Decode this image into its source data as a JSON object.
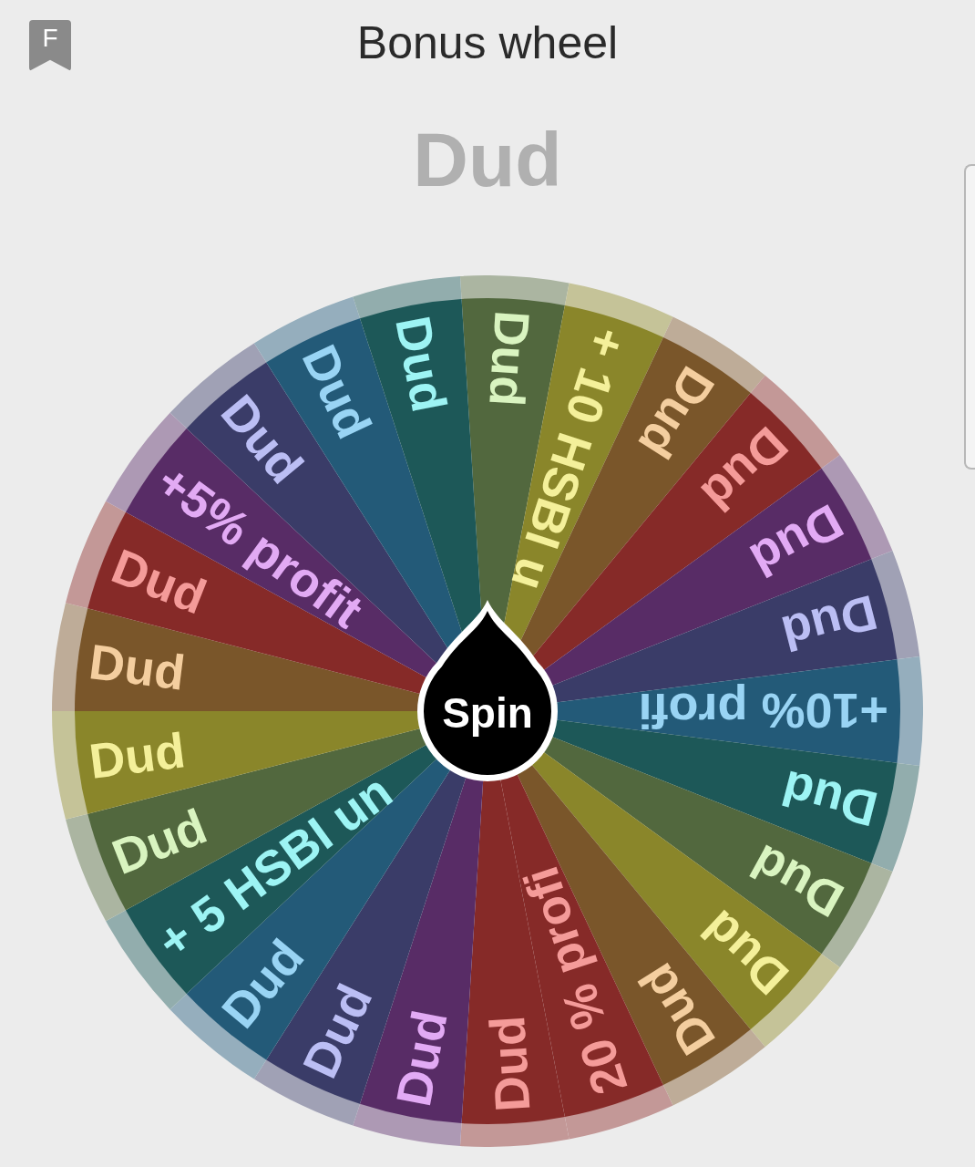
{
  "header": {
    "title": "Bonus wheel",
    "badge": "F"
  },
  "result": "Dud",
  "wheel": {
    "segments": [
      {
        "label": "Dud",
        "color": "#52683e"
      },
      {
        "label": "+ 10 HSBI u",
        "color": "#8a862a"
      },
      {
        "label": "Dud",
        "color": "#7a562a"
      },
      {
        "label": "Dud",
        "color": "#862a28"
      },
      {
        "label": "Dud",
        "color": "#582c66"
      },
      {
        "label": "Dud",
        "color": "#3a3c68"
      },
      {
        "label": "+10% profi",
        "color": "#235a78"
      },
      {
        "label": "Dud",
        "color": "#1d5858"
      },
      {
        "label": "Dud",
        "color": "#52683e"
      },
      {
        "label": "Dud",
        "color": "#8a862a"
      },
      {
        "label": "Dud",
        "color": "#7a562a"
      },
      {
        "label": "20 % profi",
        "color": "#862a28"
      },
      {
        "label": "Dud",
        "color": "#862a28"
      },
      {
        "label": "Dud",
        "color": "#582c66"
      },
      {
        "label": "Dud",
        "color": "#3a3c68"
      },
      {
        "label": "Dud",
        "color": "#235a78"
      },
      {
        "label": "+ 5 HSBI un",
        "color": "#1d5858"
      },
      {
        "label": "Dud",
        "color": "#52683e"
      },
      {
        "label": "Dud",
        "color": "#8a862a"
      },
      {
        "label": "Dud",
        "color": "#7a562a"
      },
      {
        "label": "Dud",
        "color": "#862a28"
      },
      {
        "label": "+5% profit",
        "color": "#582c66"
      },
      {
        "label": "Dud",
        "color": "#3a3c68"
      },
      {
        "label": "Dud",
        "color": "#235a78"
      },
      {
        "label": "Dud",
        "color": "#1d5858"
      }
    ]
  },
  "spin_button": {
    "label": "Spin"
  }
}
